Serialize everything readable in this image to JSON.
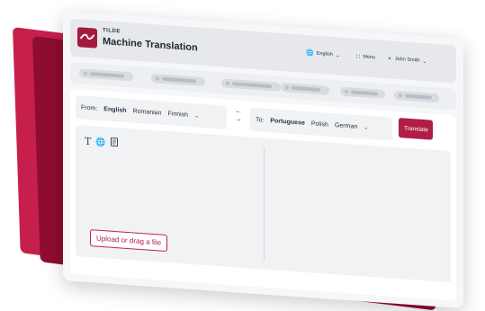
{
  "header": {
    "brand_small": "TILDE",
    "brand_title": "Machine Translation",
    "language_label": "English",
    "menu_label": "Menu",
    "user_label": "John Smith"
  },
  "from": {
    "label": "From:",
    "languages": [
      "English",
      "Romanian",
      "Finnish"
    ],
    "active": "English"
  },
  "to": {
    "label": "To:",
    "languages": [
      "Portuguese",
      "Polish",
      "German"
    ],
    "active": "Portuguese"
  },
  "actions": {
    "translate_label": "Translate",
    "upload_label": "Upload or drag a file"
  },
  "colors": {
    "accent": "#b01e45",
    "accent_dark": "#8e0d2e"
  }
}
